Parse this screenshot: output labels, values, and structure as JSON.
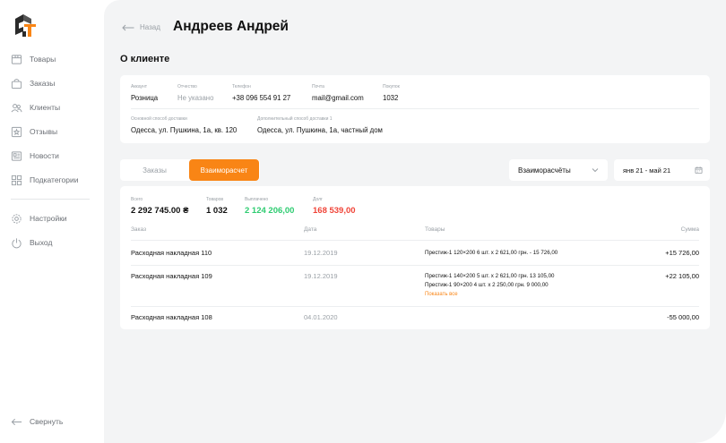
{
  "sidebar": {
    "items": [
      {
        "label": "Товары",
        "icon": "box-icon"
      },
      {
        "label": "Заказы",
        "icon": "bag-icon"
      },
      {
        "label": "Клиенты",
        "icon": "users-icon"
      },
      {
        "label": "Отзывы",
        "icon": "review-icon"
      },
      {
        "label": "Новости",
        "icon": "news-icon"
      },
      {
        "label": "Подкатегории",
        "icon": "grid-icon"
      }
    ],
    "settings": "Настройки",
    "logout": "Выход",
    "collapse": "Свернуть"
  },
  "header": {
    "back_label": "Назад",
    "title": "Андреев Андрей"
  },
  "about": {
    "title": "О клиенте",
    "account_label": "Аккаунт",
    "account_value": "Розница",
    "patronymic_label": "Отчество",
    "patronymic_value": "Не указано",
    "phone_label": "Телефон",
    "phone_value": "+38 096 554 91 27",
    "email_label": "Почта",
    "email_value": "mail@gmail.com",
    "purchases_label": "Покупок",
    "purchases_value": "1032",
    "delivery_main_label": "Основной способ доставки",
    "delivery_main_value": "Одесса, ул. Пушкина, 1а, кв. 120",
    "delivery_extra_label": "Дополнительный способ доставки 1",
    "delivery_extra_value": "Одесса, ул. Пушкина, 1а, частный дом"
  },
  "tabs": {
    "orders": "Заказы",
    "settlement": "Взаиморасчет"
  },
  "filters": {
    "type_value": "Взаиморасчёты",
    "date_range": "янв 21 - май 21"
  },
  "stats": {
    "total_label": "Всего",
    "total_value": "2 292 745.00 ₴",
    "goods_label": "Товаров",
    "goods_value": "1 032",
    "paid_label": "Выплачено",
    "paid_value": "2 124 206,00",
    "debt_label": "Долг",
    "debt_value": "168 539,00"
  },
  "table": {
    "headers": {
      "order": "Заказ",
      "date": "Дата",
      "goods": "Товары",
      "sum": "Сумма"
    },
    "rows": [
      {
        "order": "Расходная накладная 110",
        "date": "19.12.2019",
        "goods": [
          "Престиж-1 120×200 6 шт. х 2 621,00 грн. - 15 726,00"
        ],
        "sum": "+15 726,00"
      },
      {
        "order": "Расходная накладная 109",
        "date": "19.12.2019",
        "goods": [
          "Престиж-1 140×200 5 шт. х 2 621,00 грн. 13 105,00",
          "Престиж-1 90×200 4 шт. х 2 250,00 грн. 9 000,00"
        ],
        "show_all": "Показать все",
        "sum": "+22 105,00"
      },
      {
        "order": "Расходная накладная 108",
        "date": "04.01.2020",
        "goods": [],
        "sum": "-55 000,00"
      }
    ]
  },
  "colors": {
    "accent": "#f98515",
    "positive": "#2ecc71",
    "negative": "#f04438"
  }
}
